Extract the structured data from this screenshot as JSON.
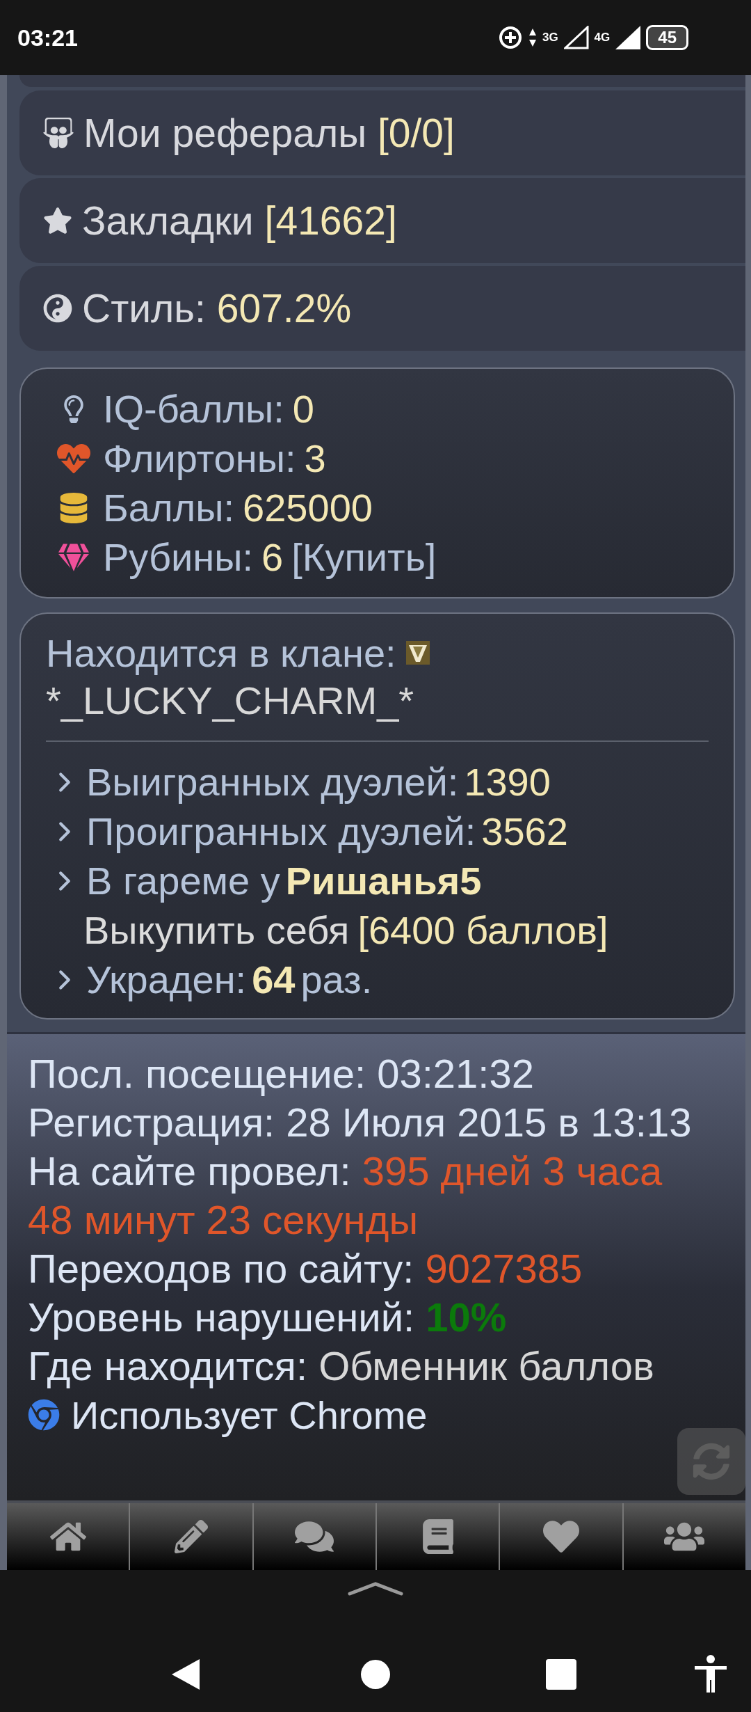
{
  "status_bar": {
    "time": "03:21",
    "network_1": "3G",
    "network_2": "4G",
    "battery": "45"
  },
  "menu": [
    {
      "label": "Мои рефералы",
      "value": "[0/0]"
    },
    {
      "label": "Закладки",
      "value": "[41662]"
    },
    {
      "label": "Стиль:",
      "value": "607.2%"
    }
  ],
  "stats": [
    {
      "label": "IQ-баллы:",
      "value": "0"
    },
    {
      "label": "Флиртоны:",
      "value": "3"
    },
    {
      "label": "Баллы:",
      "value": "625000"
    },
    {
      "label": "Рубины:",
      "value": "6",
      "link": "[Купить]"
    }
  ],
  "clan": {
    "label": "Находится в клане:",
    "name": "*_LUCKY_CHARM_*"
  },
  "duels": [
    {
      "label": "Выигранных дуэлей:",
      "value": "1390",
      "bold": false
    },
    {
      "label": "Проигранных дуэлей:",
      "value": "3562",
      "bold": false
    },
    {
      "label": "В гареме у",
      "value": "Ришанья5",
      "bold": true,
      "action": "Выкупить себя",
      "action_value": "[6400 баллов]"
    },
    {
      "label": "Украден:",
      "value": "64",
      "bold": true,
      "suffix": "раз."
    }
  ],
  "info": [
    {
      "label": "Посл. посещение:",
      "value": "03:21:32",
      "color": "#dde6f5"
    },
    {
      "label": "Регистрация:",
      "value": "28 Июля 2015 в 13:13",
      "color": "#dde6f5"
    },
    {
      "label": "На сайте провел:",
      "value": "395 дней 3 часа 48 минут 23 секунды",
      "color": "#e0562a"
    },
    {
      "label": "Переходов по сайту:",
      "value": "9027385",
      "color": "#e0562a"
    },
    {
      "label": "Уровень нарушений:",
      "value": "10%",
      "color": "#0b7a0b"
    },
    {
      "label": "Где находится:",
      "value": "Обменник баллов",
      "color": "#d8d8d8"
    }
  ],
  "browser": "Использует Chrome"
}
